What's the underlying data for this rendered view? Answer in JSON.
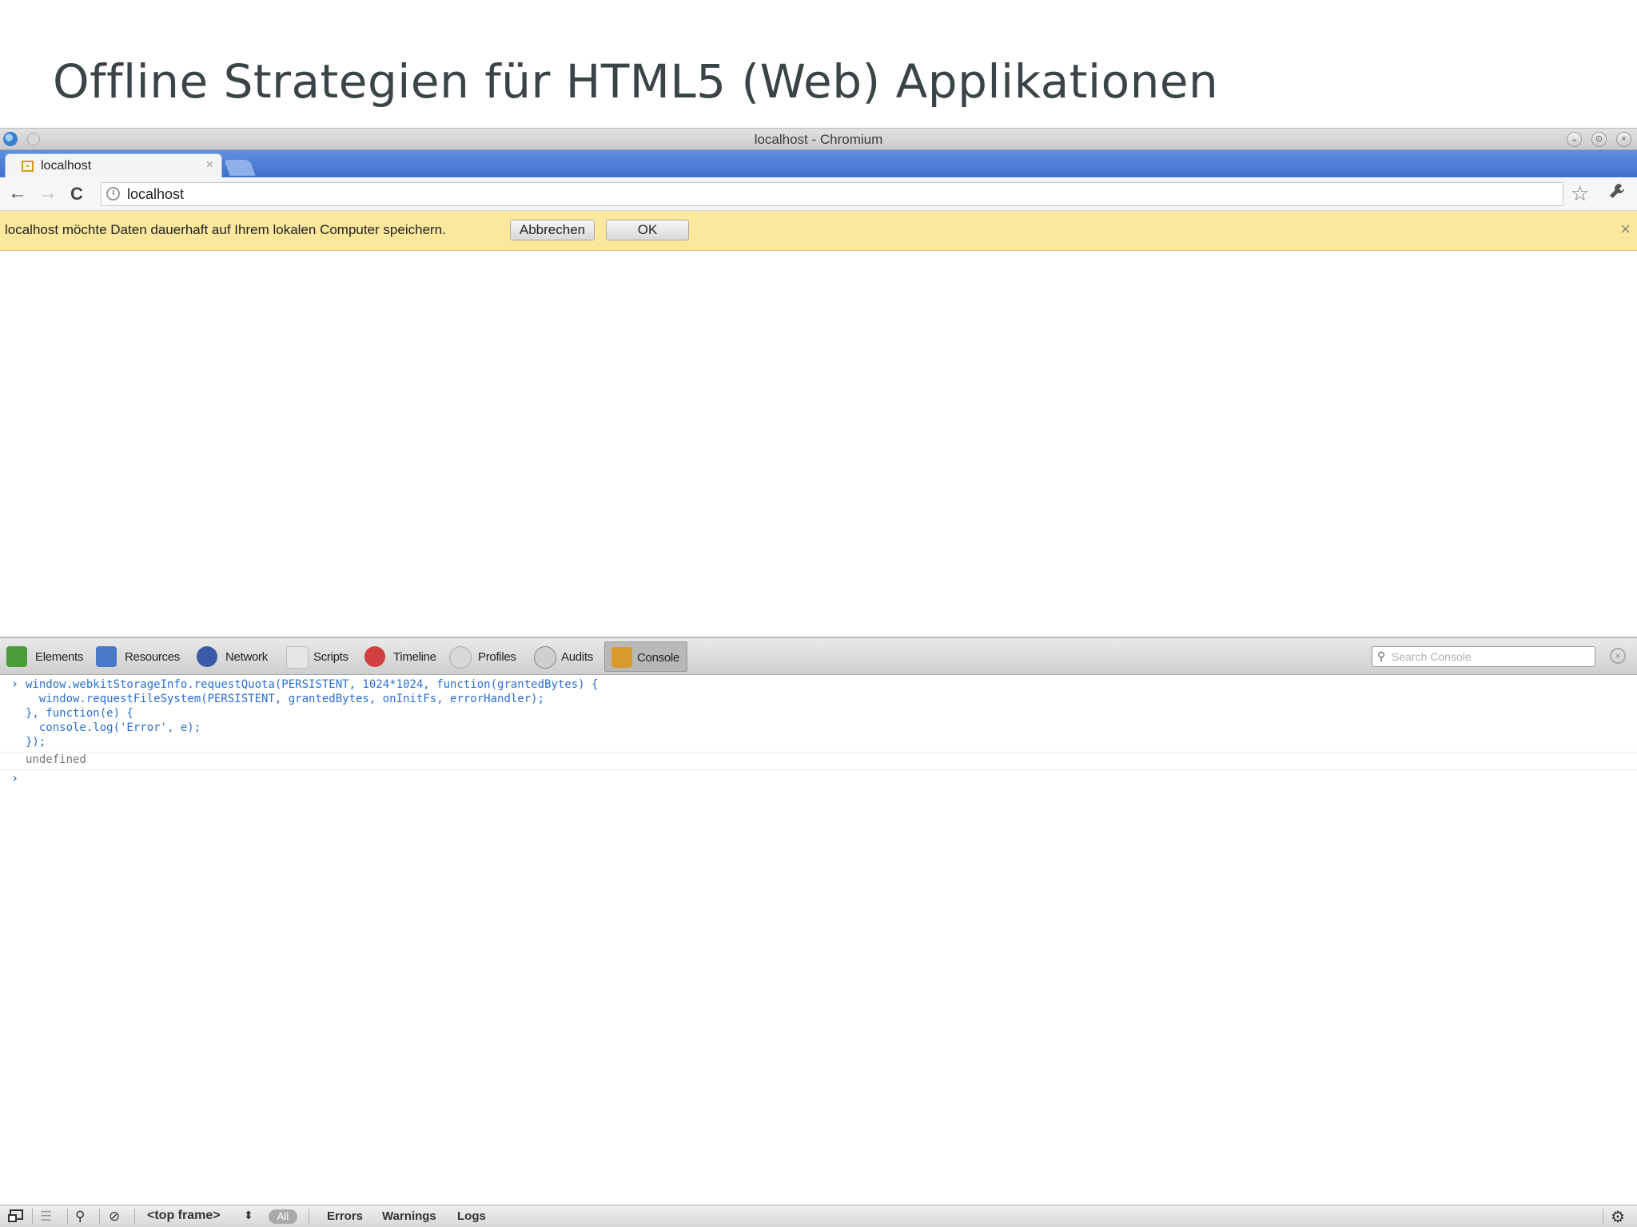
{
  "slide": {
    "title": "Offline Strategien für HTML5 (Web) Applikationen"
  },
  "window": {
    "title": "localhost - Chromium",
    "controls": [
      "minimize-icon",
      "maximize-icon",
      "close-icon"
    ]
  },
  "tab": {
    "label": "localhost",
    "close": "×"
  },
  "toolbar": {
    "back": "←",
    "forward": "→",
    "reload": "C",
    "url": "localhost",
    "star": "☆",
    "wrench": "🔧"
  },
  "infobar": {
    "message": "localhost möchte Daten dauerhaft auf Ihrem lokalen Computer speichern.",
    "cancel_label": "Abbrechen",
    "ok_label": "OK",
    "close": "×"
  },
  "devtools": {
    "tabs": [
      {
        "label": "Elements",
        "icon": "elements-icon",
        "color": "#4a9b3a"
      },
      {
        "label": "Resources",
        "icon": "resources-icon",
        "color": "#4a78c8"
      },
      {
        "label": "Network",
        "icon": "network-icon",
        "color": "#3b5aa8"
      },
      {
        "label": "Scripts",
        "icon": "scripts-icon",
        "color": "#c0c0c0"
      },
      {
        "label": "Timeline",
        "icon": "timeline-icon",
        "color": "#d04040"
      },
      {
        "label": "Profiles",
        "icon": "profiles-icon",
        "color": "#b0b0b0"
      },
      {
        "label": "Audits",
        "icon": "audits-icon",
        "color": "#909090"
      },
      {
        "label": "Console",
        "icon": "console-icon",
        "color": "#d89a2a"
      }
    ],
    "selected_tab": "Console",
    "search_placeholder": "Search Console"
  },
  "console": {
    "prompt": "›",
    "lines": [
      "window.webkitStorageInfo.requestQuota(PERSISTENT, 1024*1024, function(grantedBytes) {",
      "  window.requestFileSystem(PERSISTENT, grantedBytes, onInitFs, errorHandler);",
      "}, function(e) {",
      "  console.log('Error', e);",
      "});"
    ],
    "result": "undefined"
  },
  "statusbar": {
    "frame": "<top frame>",
    "all": "All",
    "filters": [
      "Errors",
      "Warnings",
      "Logs"
    ]
  },
  "colors": {
    "tabstrip": "#4f7fd6",
    "infobar": "#fbe89d",
    "console_text": "#2a6fd1"
  }
}
